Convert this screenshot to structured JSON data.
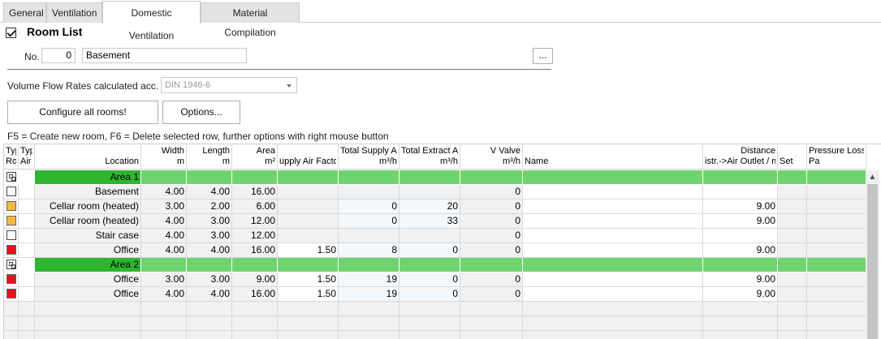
{
  "tabs": [
    {
      "label": "General",
      "active": false
    },
    {
      "label": "Ventilation",
      "active": false
    },
    {
      "label": "Domestic Ventilation",
      "active": true
    },
    {
      "label": "Material Compilation",
      "active": false
    }
  ],
  "room_list": {
    "title": "Room List",
    "checked": true,
    "no_label": "No.",
    "no_value": "0",
    "name_value": "Basement",
    "browse_label": "..."
  },
  "volume_flow": {
    "label": "Volume Flow Rates calculated acc. to:",
    "selected": "DIN 1946-6"
  },
  "buttons": {
    "configure": "Configure all rooms!",
    "options": "Options..."
  },
  "hint": "F5 = Create new room, F6 = Delete selected row, further options with right mouse button",
  "table": {
    "headers": [
      {
        "l1": "Typ",
        "l2": "Roo"
      },
      {
        "l1": "Typ",
        "l2": "Air"
      },
      {
        "l1": "",
        "l2": "Location"
      },
      {
        "l1": "Width",
        "l2": "m"
      },
      {
        "l1": "Length",
        "l2": "m"
      },
      {
        "l1": "Area",
        "l2": "m²"
      },
      {
        "l1": "",
        "l2": "upply Air Factor"
      },
      {
        "l1": "Total Supply Air",
        "l2": "m³/h"
      },
      {
        "l1": "Total Extract Air",
        "l2": "m³/h"
      },
      {
        "l1": "V Valve",
        "l2": "m³/h"
      },
      {
        "l1": "",
        "l2": "Name"
      },
      {
        "l1": "Distance",
        "l2": "istr.->Air Outlet / m"
      },
      {
        "l1": "",
        "l2": "Set"
      },
      {
        "l1": "Pressure Loss",
        "l2": "Pa"
      }
    ],
    "rows": [
      {
        "kind": "area",
        "location": "Area 1"
      },
      {
        "kind": "room",
        "type": "white",
        "location": "Basement",
        "width": "4.00",
        "length": "4.00",
        "area": "16.00",
        "factor": "",
        "supply": "",
        "extract": "",
        "valve": "0",
        "name": "",
        "distance": "",
        "set": "",
        "ploss": ""
      },
      {
        "kind": "room",
        "type": "orange",
        "location": "Cellar room (heated)",
        "width": "3.00",
        "length": "2.00",
        "area": "6.00",
        "factor": "",
        "supply": "0",
        "extract": "20",
        "valve": "0",
        "name": "",
        "distance": "9.00",
        "set": "",
        "ploss": ""
      },
      {
        "kind": "room",
        "type": "orange",
        "location": "Cellar room (heated)",
        "width": "4.00",
        "length": "3.00",
        "area": "12.00",
        "factor": "",
        "supply": "0",
        "extract": "33",
        "valve": "0",
        "name": "",
        "distance": "9.00",
        "set": "",
        "ploss": ""
      },
      {
        "kind": "room",
        "type": "white",
        "location": "Stair case",
        "width": "4.00",
        "length": "3.00",
        "area": "12.00",
        "factor": "",
        "supply": "",
        "extract": "",
        "valve": "0",
        "name": "",
        "distance": "",
        "set": "",
        "ploss": ""
      },
      {
        "kind": "room",
        "type": "red",
        "location": "Office",
        "width": "4.00",
        "length": "4.00",
        "area": "16.00",
        "factor": "1.50",
        "supply": "8",
        "extract": "0",
        "valve": "0",
        "name": "",
        "distance": "9.00",
        "set": "",
        "ploss": ""
      },
      {
        "kind": "area",
        "location": "Area 2"
      },
      {
        "kind": "room",
        "type": "red",
        "location": "Office",
        "width": "3.00",
        "length": "3.00",
        "area": "9.00",
        "factor": "1.50",
        "supply": "19",
        "extract": "0",
        "valve": "0",
        "name": "",
        "distance": "9.00",
        "set": "",
        "ploss": ""
      },
      {
        "kind": "room",
        "type": "red",
        "location": "Office",
        "width": "4.00",
        "length": "4.00",
        "area": "16.00",
        "factor": "1.50",
        "supply": "19",
        "extract": "0",
        "valve": "0",
        "name": "",
        "distance": "9.00",
        "set": "",
        "ploss": ""
      },
      {
        "kind": "empty"
      },
      {
        "kind": "empty"
      },
      {
        "kind": "empty"
      }
    ]
  },
  "colors": {
    "area_row": "#6fd46f",
    "area_selected": "#2fb52f",
    "room_orange": "#f2bb43",
    "room_red": "#e8111b"
  }
}
